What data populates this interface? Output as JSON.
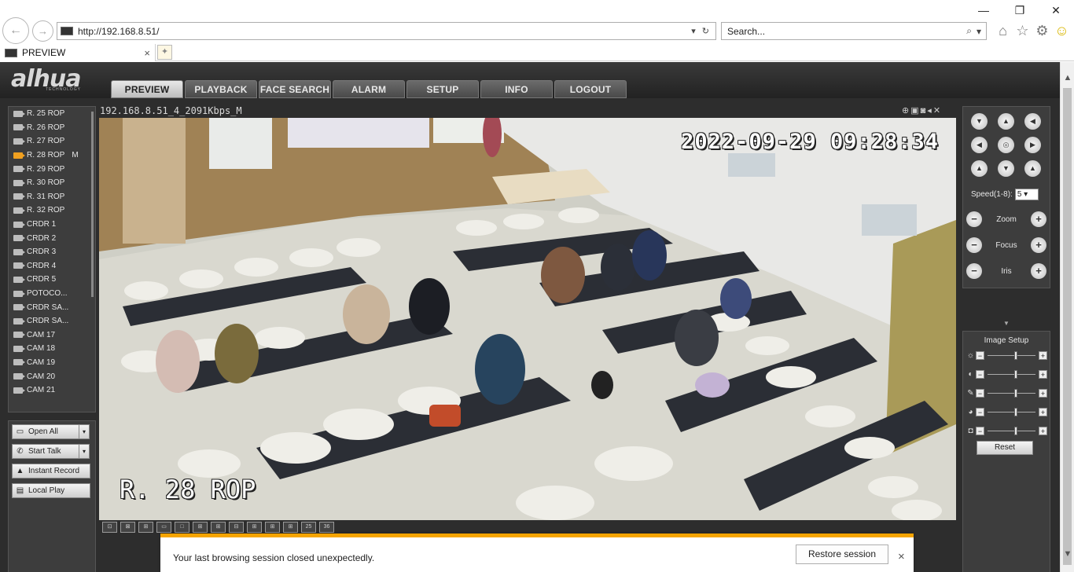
{
  "browser": {
    "url": "http://192.168.8.51/",
    "search_placeholder": "Search...",
    "tab_title": "PREVIEW",
    "window_controls": [
      "minimize-icon",
      "restore-icon",
      "close-icon"
    ],
    "toolbar_icons": [
      "home-icon",
      "star-icon",
      "gear-icon",
      "smiley-icon"
    ]
  },
  "app": {
    "logo": "alhua",
    "logo_sub": "TECHNOLOGY",
    "nav": [
      "PREVIEW",
      "PLAYBACK",
      "FACE SEARCH",
      "ALARM",
      "SETUP",
      "INFO",
      "LOGOUT"
    ],
    "active_nav": "PREVIEW"
  },
  "cameras": [
    {
      "label": "R. 25 ROP",
      "flag": ""
    },
    {
      "label": "R. 26 ROP",
      "flag": ""
    },
    {
      "label": "R. 27 ROP",
      "flag": ""
    },
    {
      "label": "R. 28 ROP",
      "flag": "M",
      "active": true
    },
    {
      "label": "R. 29 ROP",
      "flag": ""
    },
    {
      "label": "R. 30 ROP",
      "flag": ""
    },
    {
      "label": "R. 31 ROP",
      "flag": ""
    },
    {
      "label": "R. 32 ROP",
      "flag": ""
    },
    {
      "label": "CRDR 1",
      "flag": ""
    },
    {
      "label": "CRDR 2",
      "flag": ""
    },
    {
      "label": "CRDR 3",
      "flag": ""
    },
    {
      "label": "CRDR 4",
      "flag": ""
    },
    {
      "label": "CRDR 5",
      "flag": ""
    },
    {
      "label": "POTOCO...",
      "flag": ""
    },
    {
      "label": "CRDR SA...",
      "flag": ""
    },
    {
      "label": "CRDR SA...",
      "flag": ""
    },
    {
      "label": "CAM 17",
      "flag": ""
    },
    {
      "label": "CAM 18",
      "flag": ""
    },
    {
      "label": "CAM 19",
      "flag": ""
    },
    {
      "label": "CAM 20",
      "flag": ""
    },
    {
      "label": "CAM 21",
      "flag": ""
    }
  ],
  "actions": {
    "open_all": "Open All",
    "start_talk": "Start Talk",
    "instant_record": "Instant Record",
    "local_play": "Local Play"
  },
  "video": {
    "stream_title": "192.168.8.51_4_2091Kbps_M",
    "timestamp": "2022-09-29 09:28:34",
    "channel_name": "R. 28 ROP",
    "layouts": [
      "",
      "",
      "",
      "",
      "",
      "",
      "",
      "",
      "",
      "",
      "",
      "25",
      "36"
    ]
  },
  "ptz": {
    "speed_label": "Speed(1-8):",
    "speed_value": "5",
    "zoom_label": "Zoom",
    "focus_label": "Focus",
    "iris_label": "Iris"
  },
  "image_setup": {
    "title": "Image Setup",
    "sliders": [
      {
        "icon": "brightness-icon",
        "level": 0.55
      },
      {
        "icon": "contrast-icon",
        "level": 0.55
      },
      {
        "icon": "saturation-icon",
        "level": 0.55
      },
      {
        "icon": "hue-icon",
        "level": 0.55
      },
      {
        "icon": "gain-icon",
        "level": 0.55
      }
    ],
    "reset_label": "Reset"
  },
  "notification": {
    "message": "Your last browsing session closed unexpectedly.",
    "restore_label": "Restore session",
    "accent_color": "#f5a400"
  }
}
